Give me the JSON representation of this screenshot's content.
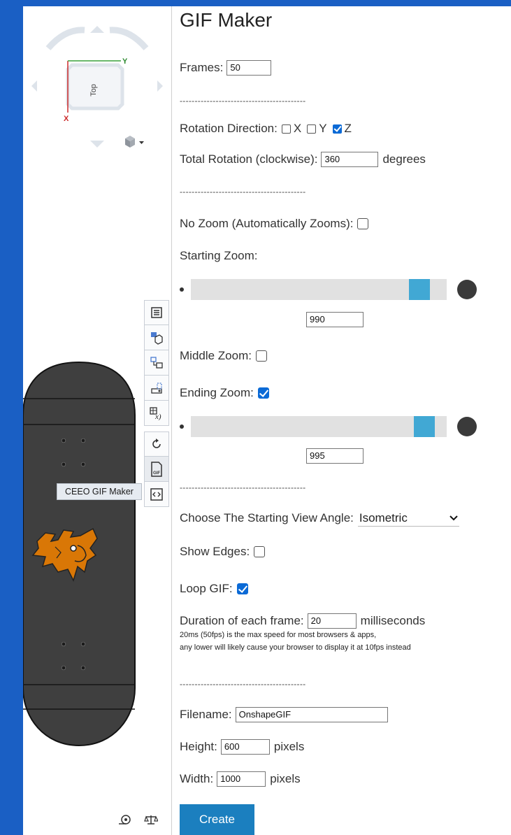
{
  "viewport": {
    "cube": {
      "top_label": "Top",
      "axis_y": "Y",
      "axis_x": "X"
    },
    "tooltip": "CEEO GIF Maker",
    "toolbar": [
      {
        "icon": "list-icon"
      },
      {
        "icon": "parts-icon"
      },
      {
        "icon": "assembly-icon"
      },
      {
        "icon": "sketch-icon"
      },
      {
        "icon": "variable-icon"
      },
      {
        "icon": "rotate-icon"
      },
      {
        "icon": "gif-icon",
        "label": "GIF"
      },
      {
        "icon": "code-icon"
      }
    ]
  },
  "panel": {
    "title": "GIF Maker",
    "frames": {
      "label": "Frames:",
      "value": "50"
    },
    "separator": "------------------------------------------",
    "rotation_direction": {
      "label": "Rotation Direction:",
      "x": "X",
      "y": "Y",
      "z": "Z",
      "z_checked": true
    },
    "total_rotation": {
      "label": "Total Rotation (clockwise):",
      "value": "360",
      "unit": "degrees"
    },
    "no_zoom": {
      "label": "No Zoom (Automatically Zooms):"
    },
    "starting_zoom": {
      "label": "Starting Zoom:",
      "value": "990",
      "level": 0.93
    },
    "middle_zoom": {
      "label": "Middle Zoom:"
    },
    "ending_zoom": {
      "label": "Ending Zoom:",
      "checked": true,
      "value": "995",
      "level": 0.95
    },
    "view_angle": {
      "label": "Choose The Starting View Angle:",
      "selected": "Isometric"
    },
    "show_edges": {
      "label": "Show Edges:"
    },
    "loop_gif": {
      "label": "Loop GIF:",
      "checked": true
    },
    "duration": {
      "label": "Duration of each frame:",
      "value": "20",
      "unit": "milliseconds",
      "note1": "20ms (50fps) is the max speed for most browsers & apps,",
      "note2": "any lower will likely cause your browser to display it at 10fps instead"
    },
    "filename": {
      "label": "Filename:",
      "value": "OnshapeGIF"
    },
    "height": {
      "label": "Height:",
      "value": "600",
      "unit": "pixels"
    },
    "width": {
      "label": "Width:",
      "value": "1000",
      "unit": "pixels"
    },
    "create_label": "Create"
  },
  "colors": {
    "accent": "#1b7fbf",
    "slider_handle": "#41a8d4",
    "background": "#1a5fc4",
    "board": "#3f3f3f",
    "logo": "#d97706"
  }
}
